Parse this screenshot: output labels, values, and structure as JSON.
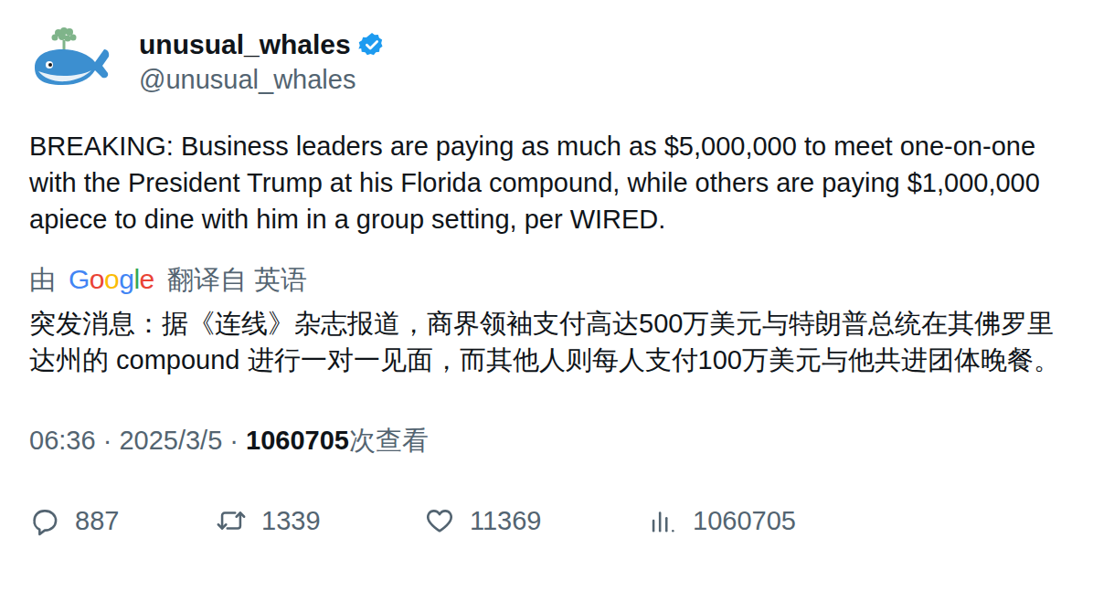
{
  "author": {
    "name": "unusual_whales",
    "handle": "@unusual_whales",
    "verified": true
  },
  "tweet": {
    "text": "BREAKING: Business leaders are paying as much as $5,000,000 to meet one-on-one with the President Trump at his Florida compound, while others are paying $1,000,000 apiece to dine with him in a group setting, per WIRED.",
    "translation_label": {
      "prefix": "由",
      "provider": "Google",
      "suffix": "翻译自 英语"
    },
    "translation": "突发消息：据《连线》杂志报道，商界领袖支付高达500万美元与特朗普总统在其佛罗里达州的 compound 进行一对一见面，而其他人则每人支付100万美元与他共进团体晚餐。",
    "time": "06:36",
    "separator": "·",
    "date": "2025/3/5",
    "views": "1060705",
    "views_label": "次查看"
  },
  "actions": [
    {
      "kind": "reply",
      "count": "887"
    },
    {
      "kind": "retweet",
      "count": "1339"
    },
    {
      "kind": "like",
      "count": "11369"
    },
    {
      "kind": "views",
      "count": "1060705"
    }
  ]
}
